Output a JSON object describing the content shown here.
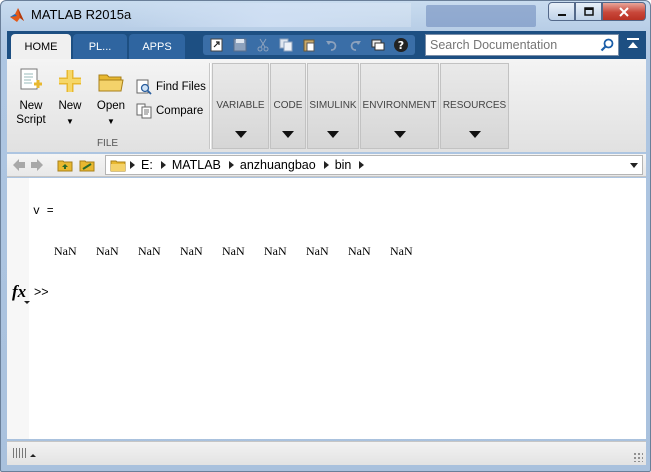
{
  "window": {
    "title": "MATLAB R2015a",
    "controls": [
      "minimize",
      "maximize",
      "close"
    ]
  },
  "tabs": [
    {
      "label": "HOME",
      "active": true
    },
    {
      "label": "PL...",
      "active": false
    },
    {
      "label": "APPS",
      "active": false
    }
  ],
  "quick_access": [
    "shortcut-icon",
    "save-icon",
    "cut-icon",
    "copy-icon",
    "paste-icon",
    "undo-icon",
    "redo-icon",
    "switch-windows-icon",
    "help-icon"
  ],
  "search": {
    "placeholder": "Search Documentation",
    "value": ""
  },
  "ribbon": {
    "file_group": {
      "label": "FILE",
      "new_script": "New Script",
      "new_script_line1": "New",
      "new_script_line2": "Script",
      "new": "New",
      "open": "Open",
      "find_files": "Find Files",
      "compare": "Compare"
    },
    "collapsed_groups": [
      "VARIABLE",
      "CODE",
      "SIMULINK",
      "ENVIRONMENT",
      "RESOURCES"
    ]
  },
  "path": {
    "crumbs": [
      "E:",
      "MATLAB",
      "anzhuangbao",
      "bin"
    ]
  },
  "command_window": {
    "var_line": "v =",
    "values": [
      "NaN",
      "NaN",
      "NaN",
      "NaN",
      "NaN",
      "NaN",
      "NaN",
      "NaN",
      "NaN"
    ],
    "fx_label": "fx",
    "prompt": ">>"
  },
  "colors": {
    "tab_strip": "#1d4f82",
    "folder": "#e8b830",
    "close_button": "#c8473a"
  }
}
